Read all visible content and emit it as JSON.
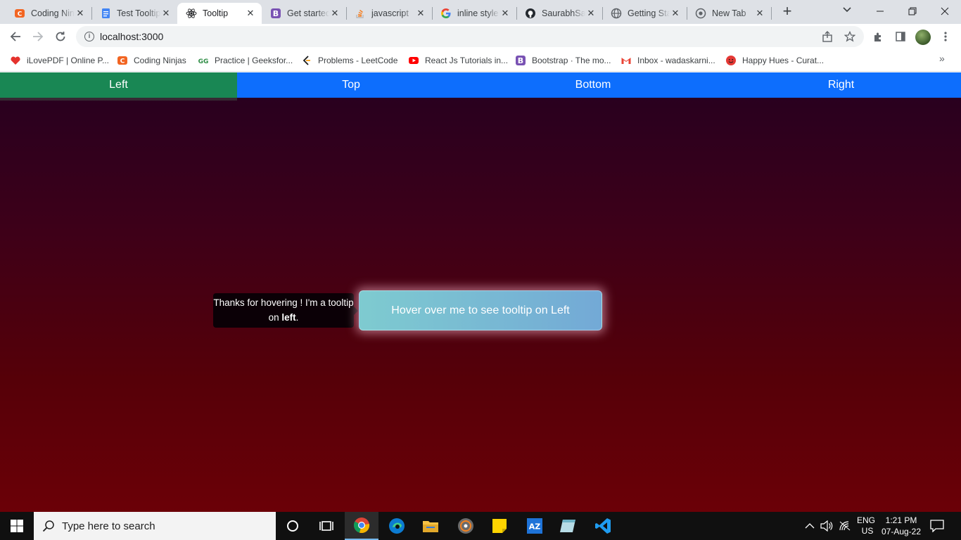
{
  "browser": {
    "tabs": [
      {
        "title": "Coding Ninjas",
        "icon": "coding-ninjas-icon",
        "color": "#f26522"
      },
      {
        "title": "Test Tooltip",
        "icon": "google-docs-icon",
        "color": "#4285f4"
      },
      {
        "title": "Tooltip",
        "icon": "react-icon",
        "color": "#61dafb",
        "active": true
      },
      {
        "title": "Get started",
        "icon": "bootstrap-icon",
        "color": "#7952b3"
      },
      {
        "title": "javascript",
        "icon": "stackoverflow-icon",
        "color": "#f48024"
      },
      {
        "title": "inline style",
        "icon": "google-icon",
        "color": "#4285f4"
      },
      {
        "title": "SaurabhSa",
        "icon": "github-icon",
        "color": "#24292f"
      },
      {
        "title": "Getting Sta",
        "icon": "globe-icon",
        "color": "#5f6368"
      },
      {
        "title": "New Tab",
        "icon": "chrome-icon",
        "color": "#5f6368"
      }
    ],
    "address": "localhost:3000",
    "bookmarks": [
      {
        "label": "iLovePDF | Online P...",
        "icon": "heart-icon",
        "color": "#e5322d"
      },
      {
        "label": "Coding Ninjas",
        "icon": "coding-ninjas-icon",
        "color": "#f26522"
      },
      {
        "label": "Practice | Geeksfor...",
        "icon": "gfg-icon",
        "color": "#2f8d46"
      },
      {
        "label": "Problems - LeetCode",
        "icon": "leetcode-icon",
        "color": "#ffa116"
      },
      {
        "label": "React Js Tutorials in...",
        "icon": "youtube-icon",
        "color": "#ff0000"
      },
      {
        "label": "Bootstrap · The mo...",
        "icon": "bootstrap-icon",
        "color": "#7952b3"
      },
      {
        "label": "Inbox - wadaskarni...",
        "icon": "gmail-icon",
        "color": "#ea4335"
      },
      {
        "label": "Happy Hues - Curat...",
        "icon": "happy-hues-icon",
        "color": "#e53935"
      }
    ]
  },
  "app": {
    "nav": [
      {
        "label": "Left",
        "active": true
      },
      {
        "label": "Top"
      },
      {
        "label": "Bottom"
      },
      {
        "label": "Right"
      }
    ],
    "button_label": "Hover over me to see tooltip on Left",
    "tooltip": {
      "text_before": "Thanks for hovering ! I'm a tooltip on ",
      "text_bold": "left",
      "text_after": "."
    },
    "colors": {
      "nav_bg": "#0d6efd",
      "nav_active": "#198754",
      "bg_top": "#250020",
      "bg_bottom": "#6b0007"
    }
  },
  "taskbar": {
    "search_placeholder": "Type here to search",
    "apps": [
      "task-view-icon",
      "chrome-icon",
      "edge-icon",
      "file-explorer-icon",
      "media-player-icon",
      "sticky-notes-icon",
      "azure-icon",
      "notepad-icon",
      "vscode-icon"
    ],
    "lang": "ENG",
    "region": "US",
    "time": "1:21 PM",
    "date": "07-Aug-22"
  }
}
